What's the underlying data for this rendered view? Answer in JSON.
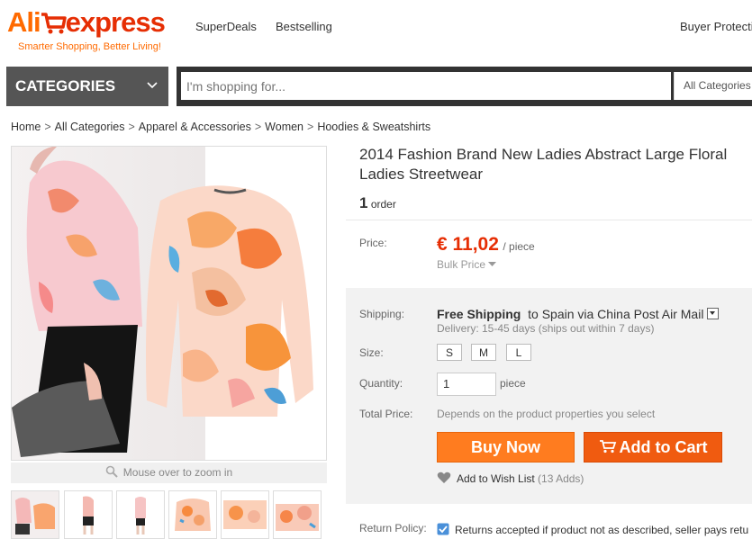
{
  "header": {
    "logo_ali": "Ali",
    "logo_express": "express",
    "tagline": "Smarter Shopping, Better Living!",
    "nav": [
      "SuperDeals",
      "Bestselling"
    ],
    "buyer_protection": "Buyer Protectio"
  },
  "categories": {
    "label": "CATEGORIES"
  },
  "search": {
    "placeholder": "I'm shopping for...",
    "scope": "All Categories"
  },
  "breadcrumb": [
    "Home",
    "All Categories",
    "Apparel & Accessories",
    "Women",
    "Hoodies & Sweatshirts"
  ],
  "gallery": {
    "zoom_hint": "Mouse over to zoom in",
    "thumb_count": 6
  },
  "product": {
    "title": "2014 Fashion Brand New Ladies Abstract Large Floral Ladies Streetwear",
    "order_count": "1",
    "order_label": "order",
    "price_label": "Price:",
    "price": "€ 11,02",
    "price_unit": "/ piece",
    "bulk_price": "Bulk Price",
    "shipping_label": "Shipping:",
    "shipping_free": "Free Shipping",
    "shipping_dest": "to  Spain via China Post Air Mail",
    "delivery": "Delivery: 15-45 days (ships out within 7 days)",
    "size_label": "Size:",
    "sizes": [
      "S",
      "M",
      "L"
    ],
    "quantity_label": "Quantity:",
    "quantity": "1",
    "quantity_unit": "piece",
    "total_label": "Total Price:",
    "total_text": "Depends on the product properties you select",
    "buy_now": "Buy Now",
    "add_to_cart": "Add to Cart",
    "wish_list": "Add to Wish List",
    "wish_count": "(13 Adds)",
    "return_label": "Return Policy:",
    "return_text": "Returns accepted if product not as described, seller pays retu"
  },
  "colors": {
    "brand_orange": "#ff6a00",
    "brand_red": "#e62e04",
    "price_red": "#e62e04"
  }
}
